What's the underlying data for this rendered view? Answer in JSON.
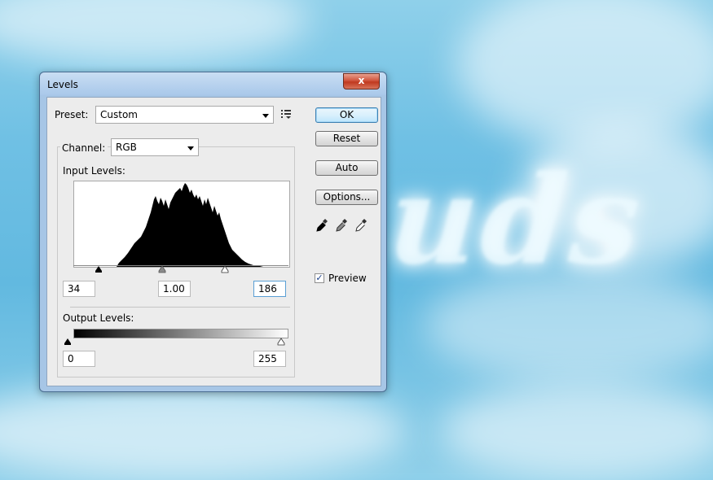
{
  "background": {
    "cloud_text": "uds"
  },
  "dialog": {
    "title": "Levels",
    "close_label": "x",
    "preset": {
      "label": "Preset:",
      "value": "Custom"
    },
    "channel": {
      "label": "Channel:",
      "value": "RGB"
    },
    "input_levels": {
      "label": "Input Levels:",
      "black": "34",
      "gamma": "1.00",
      "white": "186"
    },
    "output_levels": {
      "label": "Output Levels:",
      "black": "0",
      "white": "255"
    },
    "buttons": {
      "ok": "OK",
      "reset": "Reset",
      "auto": "Auto",
      "options": "Options..."
    },
    "preview": {
      "label": "Preview",
      "checked": true,
      "check_mark": "✓"
    },
    "eyedroppers": [
      "black-point-eyedropper-icon",
      "gray-point-eyedropper-icon",
      "white-point-eyedropper-icon"
    ]
  }
}
